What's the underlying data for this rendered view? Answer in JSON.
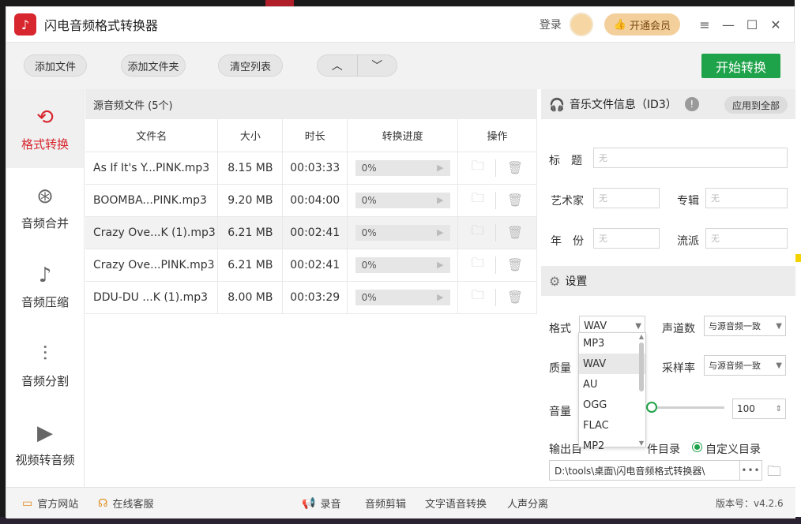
{
  "app": {
    "title": "闪电音频格式转换器",
    "logo_icon": "music-note-icon",
    "brand_color": "#d7262e",
    "accent_green": "#1fa34a"
  },
  "titlebar": {
    "login": "登录",
    "vip": "开通会员",
    "menu_icon": "≡",
    "min_icon": "—",
    "max_icon": "☐",
    "close_icon": "✕"
  },
  "toolbar": {
    "add_file": "添加文件",
    "add_folder": "添加文件夹",
    "clear_list": "清空列表",
    "up": "︿",
    "down": "﹀",
    "start": "开始转换"
  },
  "sidebar": {
    "items": [
      {
        "label": "格式转换",
        "icon": "convert-icon",
        "glyph": "⟲",
        "active": true
      },
      {
        "label": "音频合并",
        "icon": "merge-icon",
        "glyph": "⊛",
        "active": false
      },
      {
        "label": "音频压缩",
        "icon": "compress-icon",
        "glyph": "♪",
        "active": false
      },
      {
        "label": "音频分割",
        "icon": "split-icon",
        "glyph": "⫶",
        "active": false
      },
      {
        "label": "视频转音频",
        "icon": "video-icon",
        "glyph": "▶",
        "active": false
      }
    ]
  },
  "filelist": {
    "header": "源音频文件 (5个)",
    "columns": [
      "文件名",
      "大小",
      "时长",
      "转换进度",
      "操作"
    ],
    "rows": [
      {
        "name": "As If It's Y...PINK.mp3",
        "size": "8.15 MB",
        "duration": "00:03:33",
        "progress": "0%"
      },
      {
        "name": "BOOMBA...PINK.mp3",
        "size": "9.20 MB",
        "duration": "00:04:00",
        "progress": "0%"
      },
      {
        "name": "Crazy Ove...K (1).mp3",
        "size": "6.21 MB",
        "duration": "00:02:41",
        "progress": "0%"
      },
      {
        "name": "Crazy Ove...PINK.mp3",
        "size": "6.21 MB",
        "duration": "00:02:41",
        "progress": "0%"
      },
      {
        "name": "DDU-DU ...K (1).mp3",
        "size": "8.00 MB",
        "duration": "00:03:29",
        "progress": "0%"
      }
    ]
  },
  "info": {
    "header": "音乐文件信息（ID3）",
    "warn": "!",
    "apply_all": "应用到全部",
    "title_label": "标　题",
    "artist_label": "艺术家",
    "album_label": "专辑",
    "year_label": "年　份",
    "genre_label": "流派",
    "empty": "无"
  },
  "settings": {
    "header": "设置",
    "format_label": "格式",
    "format_value": "WAV",
    "channels_label": "声道数",
    "channels_value": "与源音频一致",
    "quality_label": "质量",
    "samplerate_label": "采样率",
    "samplerate_value": "与源音频一致",
    "volume_label": "音量",
    "volume_value": "100",
    "output_label": "输出目",
    "output_option_source": "件目录",
    "output_option_custom": "自定义目录",
    "path": "D:\\tools\\桌面\\闪电音频格式转换器\\",
    "more": "•••",
    "format_options": [
      "MP3",
      "WAV",
      "AU",
      "OGG",
      "FLAC",
      "MP2"
    ]
  },
  "footer": {
    "website": "官方网站",
    "support": "在线客服",
    "record": "录音",
    "cut": "音频剪辑",
    "tts": "文字语音转换",
    "vocal": "人声分离",
    "version": "版本号：v4.2.6"
  }
}
